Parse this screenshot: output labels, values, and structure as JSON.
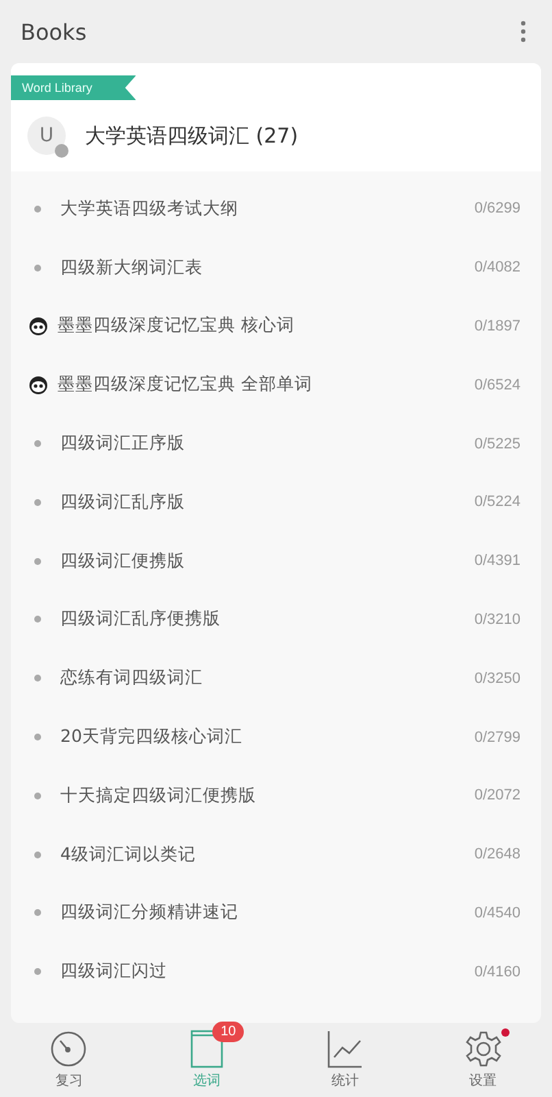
{
  "header": {
    "title": "Books"
  },
  "library": {
    "ribbon": "Word Library",
    "icon_letter": "U",
    "title": "大学英语四级词汇 (27)"
  },
  "books": [
    {
      "kind": "dot",
      "name": "大学英语四级考试大纲",
      "progress": "0/6299"
    },
    {
      "kind": "dot",
      "name": "四级新大纲词汇表",
      "progress": "0/4082"
    },
    {
      "kind": "panda",
      "name": "墨墨四级深度记忆宝典 核心词",
      "progress": "0/1897"
    },
    {
      "kind": "panda",
      "name": "墨墨四级深度记忆宝典 全部单词",
      "progress": "0/6524"
    },
    {
      "kind": "dot",
      "name": "四级词汇正序版",
      "progress": "0/5225"
    },
    {
      "kind": "dot",
      "name": "四级词汇乱序版",
      "progress": "0/5224"
    },
    {
      "kind": "dot",
      "name": "四级词汇便携版",
      "progress": "0/4391"
    },
    {
      "kind": "dot",
      "name": "四级词汇乱序便携版",
      "progress": "0/3210"
    },
    {
      "kind": "dot",
      "name": "恋练有词四级词汇",
      "progress": "0/3250"
    },
    {
      "kind": "dot",
      "name": "20天背完四级核心词汇",
      "progress": "0/2799"
    },
    {
      "kind": "dot",
      "name": "十天搞定四级词汇便携版",
      "progress": "0/2072"
    },
    {
      "kind": "dot",
      "name": "4级词汇词以类记",
      "progress": "0/2648"
    },
    {
      "kind": "dot",
      "name": "四级词汇分频精讲速记",
      "progress": "0/4540"
    },
    {
      "kind": "dot",
      "name": "四级词汇闪过",
      "progress": "0/4160"
    }
  ],
  "tabs": [
    {
      "kind": "clock",
      "label": "复习",
      "selected": false
    },
    {
      "kind": "book",
      "label": "选词",
      "selected": true,
      "badge": "10"
    },
    {
      "kind": "chart",
      "label": "统计",
      "selected": false
    },
    {
      "kind": "gear",
      "label": "设置",
      "selected": false,
      "alert": true
    }
  ]
}
